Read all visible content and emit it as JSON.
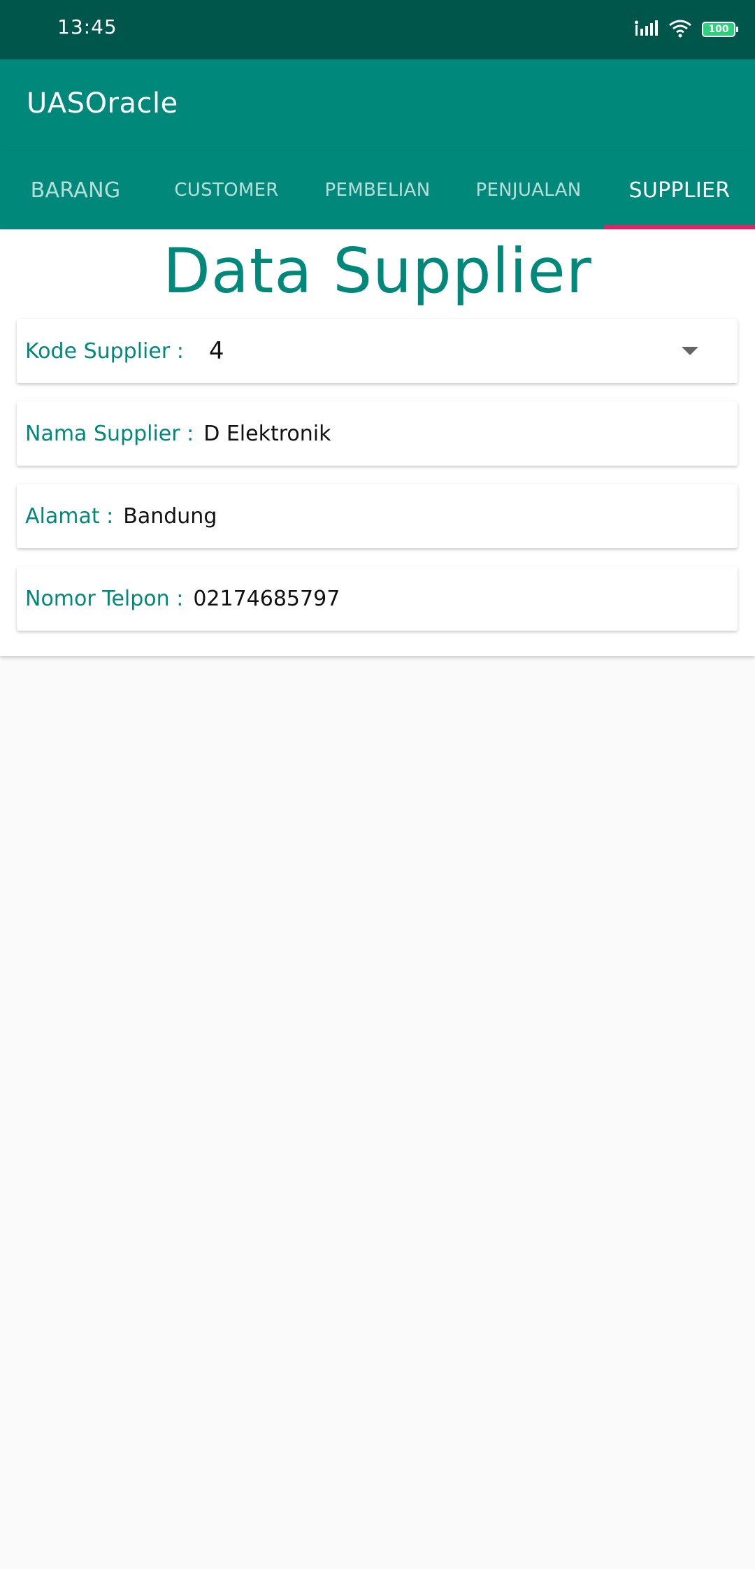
{
  "status_bar": {
    "time": "13:45",
    "battery_level": "100",
    "icons": [
      "signal-icon",
      "wifi-icon",
      "battery-icon"
    ]
  },
  "app_bar": {
    "title": "UASOracle"
  },
  "tabs": [
    {
      "label": "BARANG",
      "active": false
    },
    {
      "label": "CUSTOMER",
      "active": false
    },
    {
      "label": "PEMBELIAN",
      "active": false
    },
    {
      "label": "PENJUALAN",
      "active": false
    },
    {
      "label": "SUPPLIER",
      "active": true
    }
  ],
  "page": {
    "heading": "Data Supplier"
  },
  "fields": {
    "kode": {
      "label": "Kode Supplier :",
      "value": "4"
    },
    "nama": {
      "label": "Nama Supplier :",
      "value": "D Elektronik"
    },
    "alamat": {
      "label": "Alamat :",
      "value": "Bandung"
    },
    "telpon": {
      "label": "Nomor Telpon :",
      "value": "02174685797"
    }
  },
  "colors": {
    "status_bar": "#00564a",
    "primary": "#00897b",
    "tab_indicator": "#e91e63",
    "background": "#fafafa"
  }
}
